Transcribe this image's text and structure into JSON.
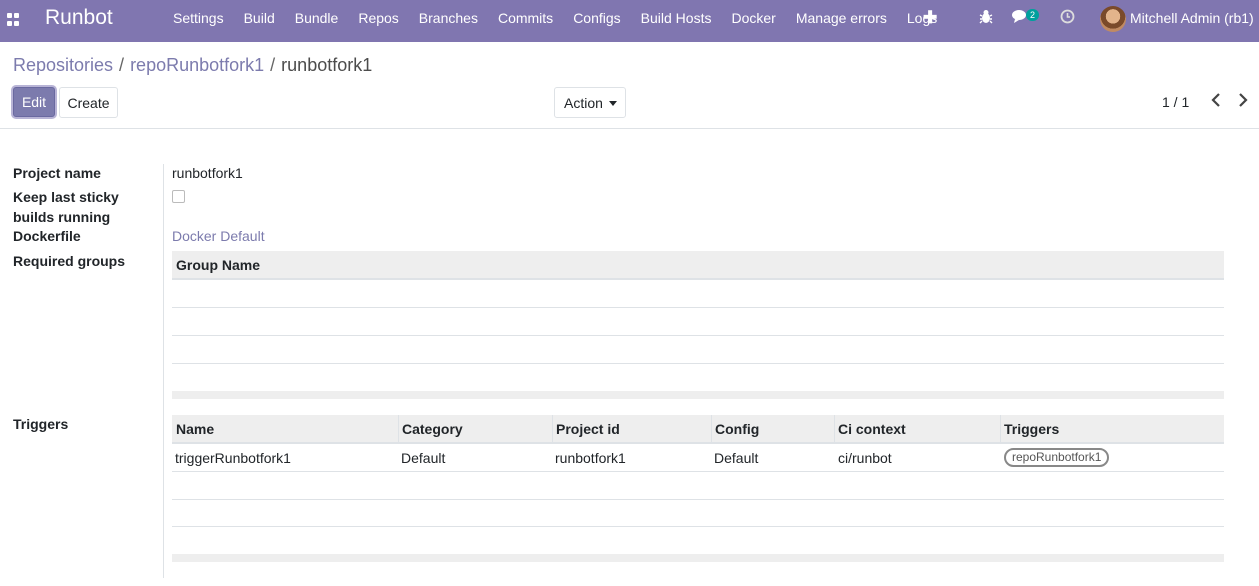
{
  "navbar": {
    "brand": "Runbot",
    "menu": [
      "Settings",
      "Build",
      "Bundle",
      "Repos",
      "Branches",
      "Commits",
      "Configs",
      "Build Hosts",
      "Docker",
      "Manage errors",
      "Logs"
    ],
    "icons": [
      "plus-icon",
      "bug-icon",
      "chat-icon",
      "clock-icon"
    ],
    "chat_badge": "2",
    "user": "Mitchell Admin (rb1)"
  },
  "breadcrumb": {
    "item1": "Repositories",
    "item2": "repoRunbotfork1",
    "current": "runbotfork1",
    "sep": "/"
  },
  "buttons": {
    "edit": "Edit",
    "create": "Create",
    "action": "Action"
  },
  "pager": {
    "value": "1 / 1"
  },
  "form": {
    "project_name_label": "Project name",
    "project_name": "runbotfork1",
    "keep_sticky_label_1": "Keep last sticky",
    "keep_sticky_label_2": "builds running",
    "keep_sticky_checked": false,
    "dockerfile_label": "Dockerfile",
    "dockerfile": "Docker Default",
    "required_groups_label": "Required groups",
    "groups_table": {
      "headers": [
        "Group Name"
      ],
      "rows": []
    },
    "triggers_label": "Triggers",
    "triggers_table": {
      "headers": [
        "Name",
        "Category",
        "Project id",
        "Config",
        "Ci context",
        "Triggers"
      ],
      "rows": [
        [
          "triggerRunbotfork1",
          "Default",
          "runbotfork1",
          "Default",
          "ci/runbot",
          "repoRunbotfork1"
        ]
      ]
    }
  },
  "colors": {
    "navbar": "#8076b0",
    "primary": "#7c7bad",
    "badge": "#00a09d"
  }
}
